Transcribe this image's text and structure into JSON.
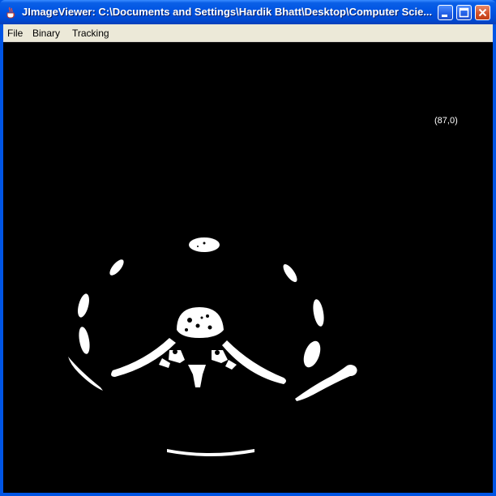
{
  "window": {
    "title": "JImageViewer: C:\\Documents and Settings\\Hardik Bhatt\\Desktop\\Computer Scie...",
    "app_icon": "java-cup-icon",
    "controls": [
      "minimize-icon",
      "maximize-icon",
      "close-icon"
    ]
  },
  "menubar": {
    "items": [
      {
        "label": "File"
      },
      {
        "label": "Binary"
      },
      {
        "label": "Tracking"
      }
    ]
  },
  "canvas": {
    "background": "#000000",
    "foreground": "#ffffff",
    "coordinate_readout": "(87,0)"
  },
  "colors": {
    "titlebar_blue": "#0054e3",
    "menubar_bg": "#ece9d8",
    "close_red": "#d4532b"
  }
}
